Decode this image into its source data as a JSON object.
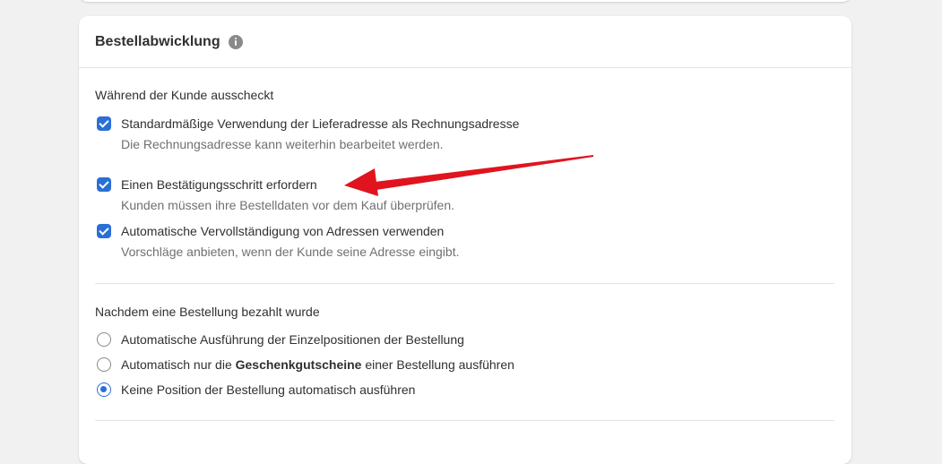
{
  "card": {
    "title": "Bestellabwicklung",
    "info_icon": "info-icon"
  },
  "checkout_section": {
    "heading": "Während der Kunde ausscheckt",
    "options": [
      {
        "label": "Standardmäßige Verwendung der Lieferadresse als Rechnungsadresse",
        "help": "Die Rechnungsadresse kann weiterhin bearbeitet werden.",
        "checked": true
      },
      {
        "label": "Einen Bestätigungsschritt erfordern",
        "help": "Kunden müssen ihre Bestelldaten vor dem Kauf überprüfen.",
        "checked": true
      },
      {
        "label": "Automatische Vervollständigung von Adressen verwenden",
        "help": "Vorschläge anbieten, wenn der Kunde seine Adresse eingibt.",
        "checked": true
      }
    ]
  },
  "paid_section": {
    "heading": "Nachdem eine Bestellung bezahlt wurde",
    "options": [
      {
        "label": "Automatische Ausführung der Einzelpositionen der Bestellung",
        "selected": false
      },
      {
        "label_prefix": "Automatisch nur die ",
        "label_bold": "Geschenkgutscheine",
        "label_suffix": " einer Bestellung ausführen",
        "selected": false
      },
      {
        "label": "Keine Position der Bestellung automatisch ausführen",
        "selected": true
      }
    ]
  },
  "colors": {
    "accent": "#2a6fd6",
    "annotation_arrow": "#e0141e"
  }
}
